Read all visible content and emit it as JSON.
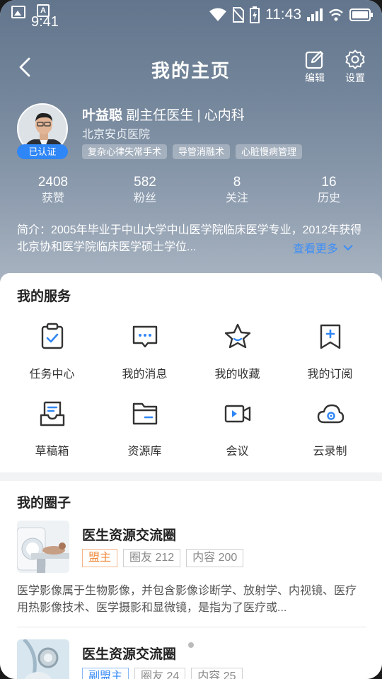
{
  "status_bar": {
    "time_left": "9:41",
    "time": "11:43"
  },
  "nav": {
    "title": "我的主页",
    "edit_label": "编辑",
    "settings_label": "设置"
  },
  "profile": {
    "name": "叶益聪",
    "title": "副主任医生 | 心内科",
    "hospital": "北京安贞医院",
    "verified": "已认证",
    "tags": [
      "复杂心律失常手术",
      "导管消融术",
      "心脏慢病管理"
    ]
  },
  "stats": [
    {
      "value": "2408",
      "label": "获赞"
    },
    {
      "value": "582",
      "label": "粉丝"
    },
    {
      "value": "8",
      "label": "关注"
    },
    {
      "value": "16",
      "label": "历史"
    }
  ],
  "intro": {
    "text": "简介：2005年毕业于中山大学中山医学院临床医学专业，2012年获得北京协和医学院临床医学硕士学位...",
    "more_label": "查看更多"
  },
  "services": {
    "title": "我的服务",
    "items": [
      {
        "label": "任务中心",
        "icon": "task-clipboard-icon"
      },
      {
        "label": "我的消息",
        "icon": "message-icon"
      },
      {
        "label": "我的收藏",
        "icon": "star-icon"
      },
      {
        "label": "我的订阅",
        "icon": "bookmark-add-icon"
      },
      {
        "label": "草稿箱",
        "icon": "drafts-icon"
      },
      {
        "label": "资源库",
        "icon": "folder-icon"
      },
      {
        "label": "会议",
        "icon": "video-icon"
      },
      {
        "label": "云录制",
        "icon": "cloud-record-icon"
      }
    ]
  },
  "circles": {
    "title": "我的圈子",
    "items": [
      {
        "name": "医生资源交流圈",
        "role": "盟主",
        "members": "圈友 212",
        "content": "内容 200",
        "desc": "医学影像属于生物影像，并包含影像诊断学、放射学、内视镜、医疗用热影像技术、医学摄影和显微镜，是指为了医疗或..."
      },
      {
        "name": "医生资源交流圈",
        "role": "副盟主",
        "members": "圈友 24",
        "content": "内容 25"
      }
    ]
  },
  "colors": {
    "accent": "#2f86f6",
    "owner": "#f08a3c",
    "hero": "#6f8298"
  }
}
